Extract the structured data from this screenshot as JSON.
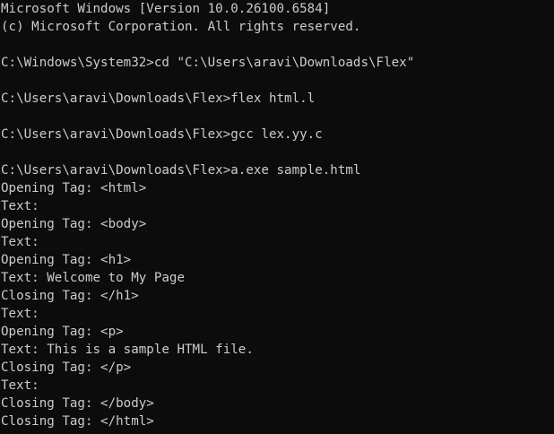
{
  "terminal": {
    "lines": [
      "Microsoft Windows [Version 10.0.26100.6584]",
      "(c) Microsoft Corporation. All rights reserved.",
      "",
      "C:\\Windows\\System32>cd \"C:\\Users\\aravi\\Downloads\\Flex\"",
      "",
      "C:\\Users\\aravi\\Downloads\\Flex>flex html.l",
      "",
      "C:\\Users\\aravi\\Downloads\\Flex>gcc lex.yy.c",
      "",
      "C:\\Users\\aravi\\Downloads\\Flex>a.exe sample.html",
      "Opening Tag: <html>",
      "Text:",
      "Opening Tag: <body>",
      "Text:",
      "Opening Tag: <h1>",
      "Text: Welcome to My Page",
      "Closing Tag: </h1>",
      "Text:",
      "Opening Tag: <p>",
      "Text: This is a sample HTML file.",
      "Closing Tag: </p>",
      "Text:",
      "Closing Tag: </body>",
      "Closing Tag: </html>"
    ]
  },
  "colors": {
    "background": "#0c0c0c",
    "foreground": "#cccccc"
  }
}
